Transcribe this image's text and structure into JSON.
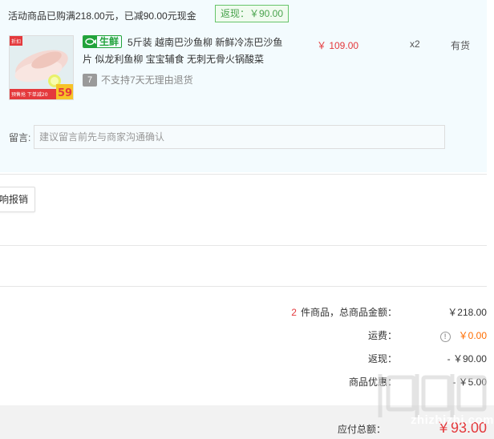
{
  "promo": {
    "text": "活动商品已购满218.00元，已减90.00元现金",
    "rebate_badge": "返现：￥90.00"
  },
  "item": {
    "thumb_badge_top": "折扣",
    "thumb_promo": "预售抢 下单减20",
    "thumb_price": "59",
    "fresh_tag": "生鲜",
    "title": "5斤装 越南巴沙鱼柳 新鲜冷冻巴沙鱼片 似龙利鱼柳 宝宝辅食 无刺无骨火锅酸菜",
    "no_return_icon": "7",
    "no_return_text": "不支持7天无理由退货",
    "price": "￥ 109.00",
    "quantity": "x2",
    "stock": "有货"
  },
  "remark": {
    "label": "留言:",
    "placeholder": "建议留言前先与商家沟通确认"
  },
  "invoice_button": "响报销",
  "summary": {
    "count": "2",
    "count_suffix": "件商品，总商品金额：",
    "total_goods": "￥218.00",
    "shipping_label": "运费：",
    "shipping_value": "￥0.00",
    "rebate_label": "返现：",
    "rebate_value": "- ￥90.00",
    "discount_label": "商品优惠：",
    "discount_value": "- ￥5.00"
  },
  "total": {
    "label": "应付总额：",
    "value": "￥93.00"
  },
  "watermark": {
    "text": "zhizhizhi.com"
  },
  "colors": {
    "accent_red": "#e4393c",
    "fresh_green": "#21a33a",
    "rebate_green": "#49a34d",
    "panel_bg": "#f3fbfe"
  }
}
